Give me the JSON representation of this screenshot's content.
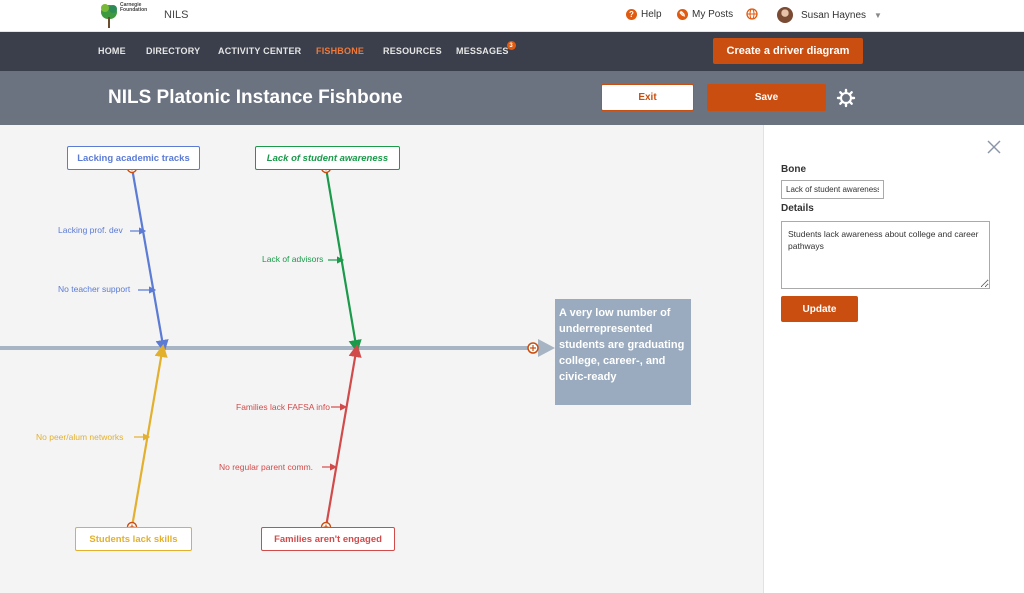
{
  "topbar": {
    "logo_text": "Carnegie Foundation",
    "app_name": "NILS",
    "help": "Help",
    "my_posts": "My Posts",
    "user_name": "Susan Haynes"
  },
  "nav": {
    "items": [
      "HOME",
      "DIRECTORY",
      "ACTIVITY CENTER",
      "FISHBONE",
      "RESOURCES",
      "MESSAGES"
    ],
    "active": "FISHBONE",
    "messages_badge": "3",
    "driver_button": "Create a driver diagram"
  },
  "titlebar": {
    "title": "NILS Platonic Instance Fishbone",
    "exit": "Exit",
    "save": "Save"
  },
  "fishbone": {
    "head": "A very low number of underrepresented students are graduating college, career-, and civic-ready",
    "colors": {
      "blue": "#5b7bd5",
      "green": "#1a9a4a",
      "yellow": "#e3b02e",
      "red": "#d24b4b",
      "spine": "#a7b4c4",
      "node": "#c94e10"
    },
    "bones": [
      {
        "label": "Lacking academic tracks",
        "subs": [
          "Lacking prof. dev",
          "No teacher support"
        ]
      },
      {
        "label": "Lack of student awareness",
        "subs": [
          "Lack of advisors"
        ]
      },
      {
        "label": "Students lack skills",
        "subs": [
          "No peer/alum networks"
        ]
      },
      {
        "label": "Families aren't engaged",
        "subs": [
          "Families lack FAFSA info",
          "No regular parent comm."
        ]
      }
    ]
  },
  "panel": {
    "bone_label": "Bone",
    "bone_value": "Lack of student awareness",
    "details_label": "Details",
    "details_value": "Students lack awareness about college and career pathways",
    "update": "Update"
  }
}
